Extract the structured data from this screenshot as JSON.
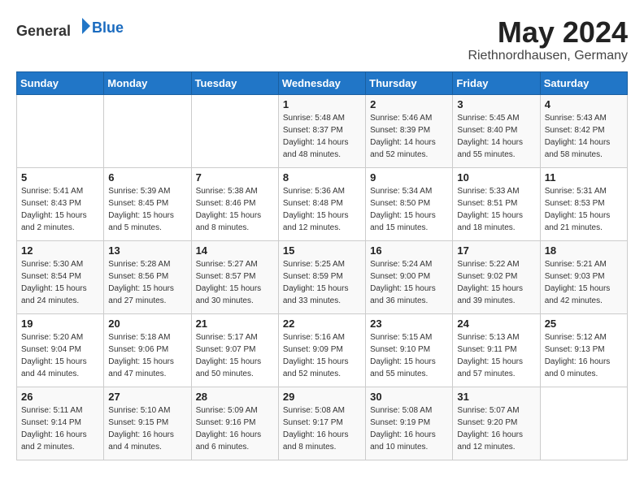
{
  "header": {
    "logo_general": "General",
    "logo_blue": "Blue",
    "month_year": "May 2024",
    "location": "Riethnordhausen, Germany"
  },
  "days_of_week": [
    "Sunday",
    "Monday",
    "Tuesday",
    "Wednesday",
    "Thursday",
    "Friday",
    "Saturday"
  ],
  "weeks": [
    [
      {
        "day": "",
        "info": ""
      },
      {
        "day": "",
        "info": ""
      },
      {
        "day": "",
        "info": ""
      },
      {
        "day": "1",
        "info": "Sunrise: 5:48 AM\nSunset: 8:37 PM\nDaylight: 14 hours\nand 48 minutes."
      },
      {
        "day": "2",
        "info": "Sunrise: 5:46 AM\nSunset: 8:39 PM\nDaylight: 14 hours\nand 52 minutes."
      },
      {
        "day": "3",
        "info": "Sunrise: 5:45 AM\nSunset: 8:40 PM\nDaylight: 14 hours\nand 55 minutes."
      },
      {
        "day": "4",
        "info": "Sunrise: 5:43 AM\nSunset: 8:42 PM\nDaylight: 14 hours\nand 58 minutes."
      }
    ],
    [
      {
        "day": "5",
        "info": "Sunrise: 5:41 AM\nSunset: 8:43 PM\nDaylight: 15 hours\nand 2 minutes."
      },
      {
        "day": "6",
        "info": "Sunrise: 5:39 AM\nSunset: 8:45 PM\nDaylight: 15 hours\nand 5 minutes."
      },
      {
        "day": "7",
        "info": "Sunrise: 5:38 AM\nSunset: 8:46 PM\nDaylight: 15 hours\nand 8 minutes."
      },
      {
        "day": "8",
        "info": "Sunrise: 5:36 AM\nSunset: 8:48 PM\nDaylight: 15 hours\nand 12 minutes."
      },
      {
        "day": "9",
        "info": "Sunrise: 5:34 AM\nSunset: 8:50 PM\nDaylight: 15 hours\nand 15 minutes."
      },
      {
        "day": "10",
        "info": "Sunrise: 5:33 AM\nSunset: 8:51 PM\nDaylight: 15 hours\nand 18 minutes."
      },
      {
        "day": "11",
        "info": "Sunrise: 5:31 AM\nSunset: 8:53 PM\nDaylight: 15 hours\nand 21 minutes."
      }
    ],
    [
      {
        "day": "12",
        "info": "Sunrise: 5:30 AM\nSunset: 8:54 PM\nDaylight: 15 hours\nand 24 minutes."
      },
      {
        "day": "13",
        "info": "Sunrise: 5:28 AM\nSunset: 8:56 PM\nDaylight: 15 hours\nand 27 minutes."
      },
      {
        "day": "14",
        "info": "Sunrise: 5:27 AM\nSunset: 8:57 PM\nDaylight: 15 hours\nand 30 minutes."
      },
      {
        "day": "15",
        "info": "Sunrise: 5:25 AM\nSunset: 8:59 PM\nDaylight: 15 hours\nand 33 minutes."
      },
      {
        "day": "16",
        "info": "Sunrise: 5:24 AM\nSunset: 9:00 PM\nDaylight: 15 hours\nand 36 minutes."
      },
      {
        "day": "17",
        "info": "Sunrise: 5:22 AM\nSunset: 9:02 PM\nDaylight: 15 hours\nand 39 minutes."
      },
      {
        "day": "18",
        "info": "Sunrise: 5:21 AM\nSunset: 9:03 PM\nDaylight: 15 hours\nand 42 minutes."
      }
    ],
    [
      {
        "day": "19",
        "info": "Sunrise: 5:20 AM\nSunset: 9:04 PM\nDaylight: 15 hours\nand 44 minutes."
      },
      {
        "day": "20",
        "info": "Sunrise: 5:18 AM\nSunset: 9:06 PM\nDaylight: 15 hours\nand 47 minutes."
      },
      {
        "day": "21",
        "info": "Sunrise: 5:17 AM\nSunset: 9:07 PM\nDaylight: 15 hours\nand 50 minutes."
      },
      {
        "day": "22",
        "info": "Sunrise: 5:16 AM\nSunset: 9:09 PM\nDaylight: 15 hours\nand 52 minutes."
      },
      {
        "day": "23",
        "info": "Sunrise: 5:15 AM\nSunset: 9:10 PM\nDaylight: 15 hours\nand 55 minutes."
      },
      {
        "day": "24",
        "info": "Sunrise: 5:13 AM\nSunset: 9:11 PM\nDaylight: 15 hours\nand 57 minutes."
      },
      {
        "day": "25",
        "info": "Sunrise: 5:12 AM\nSunset: 9:13 PM\nDaylight: 16 hours\nand 0 minutes."
      }
    ],
    [
      {
        "day": "26",
        "info": "Sunrise: 5:11 AM\nSunset: 9:14 PM\nDaylight: 16 hours\nand 2 minutes."
      },
      {
        "day": "27",
        "info": "Sunrise: 5:10 AM\nSunset: 9:15 PM\nDaylight: 16 hours\nand 4 minutes."
      },
      {
        "day": "28",
        "info": "Sunrise: 5:09 AM\nSunset: 9:16 PM\nDaylight: 16 hours\nand 6 minutes."
      },
      {
        "day": "29",
        "info": "Sunrise: 5:08 AM\nSunset: 9:17 PM\nDaylight: 16 hours\nand 8 minutes."
      },
      {
        "day": "30",
        "info": "Sunrise: 5:08 AM\nSunset: 9:19 PM\nDaylight: 16 hours\nand 10 minutes."
      },
      {
        "day": "31",
        "info": "Sunrise: 5:07 AM\nSunset: 9:20 PM\nDaylight: 16 hours\nand 12 minutes."
      },
      {
        "day": "",
        "info": ""
      }
    ]
  ]
}
